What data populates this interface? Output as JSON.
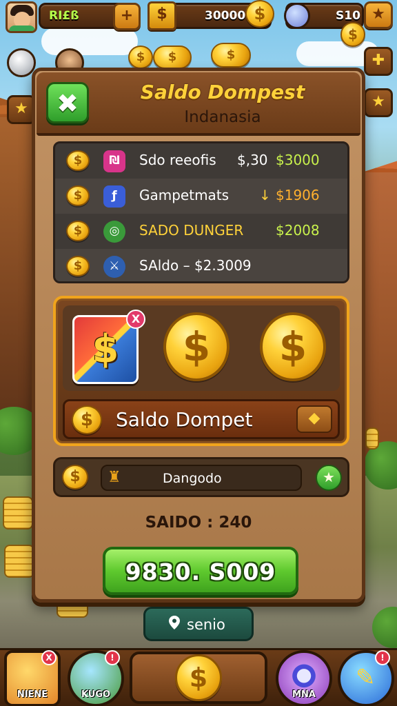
{
  "topbar": {
    "player_name": "RI£ß",
    "coins_value": "30000",
    "gems_value": "S10"
  },
  "panel": {
    "title": "Saldo Dompest",
    "subtitle": "Indanasia",
    "rows": [
      {
        "label": "Sdo reeofis",
        "amount": "$,30",
        "value": "$3000"
      },
      {
        "label": "Gampetmats",
        "amount": "↓",
        "value": "$1906"
      },
      {
        "label": "SADO DUNGER",
        "amount": "",
        "value": "$2008"
      },
      {
        "label": "SAldo – $2.3009",
        "amount": "",
        "value": ""
      }
    ],
    "x_badge": "X",
    "saldo_label": "Saldo Dompet",
    "search_value": "Dangodo",
    "balance_label": "SAIDO : 240",
    "cta_label": "9830. S009"
  },
  "location_chip": "senio",
  "bottom_nav": [
    {
      "label": "NIENE",
      "badge": "X"
    },
    {
      "label": "KUGO",
      "badge": "!"
    },
    {
      "label": "MNA",
      "badge": ""
    },
    {
      "label": "",
      "badge": "!"
    }
  ],
  "colors": {
    "panel_wood": "#c29364",
    "title_gold": "#ffd23a",
    "cta_green": "#5fc92e",
    "frame_orange": "#f0a41c"
  }
}
